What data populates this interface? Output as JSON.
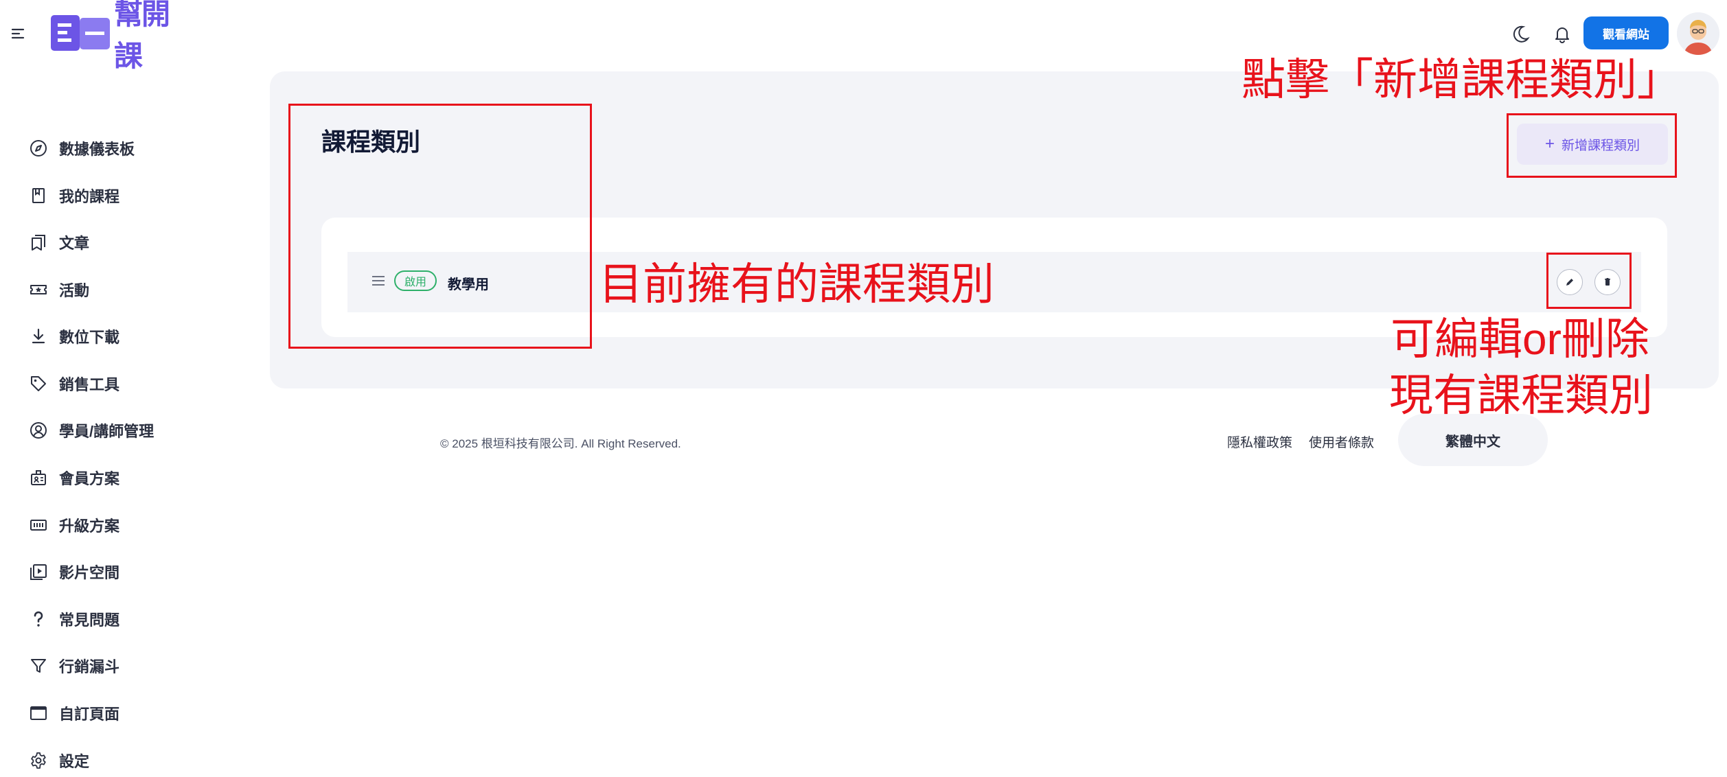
{
  "header": {
    "logo_text": "幫開課",
    "view_site_label": "觀看網站",
    "icons": [
      "menu-icon",
      "moon-icon",
      "bell-icon"
    ]
  },
  "sidebar": {
    "items": [
      {
        "label": "數據儀表板",
        "icon": "compass-icon"
      },
      {
        "label": "我的課程",
        "icon": "book-icon"
      },
      {
        "label": "文章",
        "icon": "bookmarks-icon"
      },
      {
        "label": "活動",
        "icon": "ticket-icon"
      },
      {
        "label": "數位下載",
        "icon": "download-icon"
      },
      {
        "label": "銷售工具",
        "icon": "tag-icon"
      },
      {
        "label": "學員/講師管理",
        "icon": "user-circle-icon"
      },
      {
        "label": "會員方案",
        "icon": "badge-icon"
      },
      {
        "label": "升級方案",
        "icon": "upgrade-icon"
      },
      {
        "label": "影片空間",
        "icon": "video-library-icon"
      },
      {
        "label": "常見問題",
        "icon": "question-icon"
      },
      {
        "label": "行銷漏斗",
        "icon": "funnel-icon"
      },
      {
        "label": "自訂頁面",
        "icon": "window-icon"
      },
      {
        "label": "設定",
        "icon": "gear-icon"
      }
    ]
  },
  "main": {
    "title": "課程類別",
    "add_button_label": "新增課程類別",
    "categories": [
      {
        "status": "啟用",
        "name": "教學用"
      }
    ]
  },
  "footer": {
    "copyright": "© 2025 根垣科技有限公司. All Right Reserved.",
    "privacy_label": "隱私權政策",
    "terms_label": "使用者條款",
    "language_label": "繁體中文"
  },
  "annotations": {
    "click_add": "點擊「新增課程類別」",
    "existing": "目前擁有的課程類別",
    "edit_delete_line1": "可編輯or刪除",
    "edit_delete_line2": "現有課程類別"
  },
  "colors": {
    "brand": "#6c55e6",
    "primary_button": "#1273e6",
    "status_active": "#2eb06a",
    "annotation": "#e8121b"
  }
}
